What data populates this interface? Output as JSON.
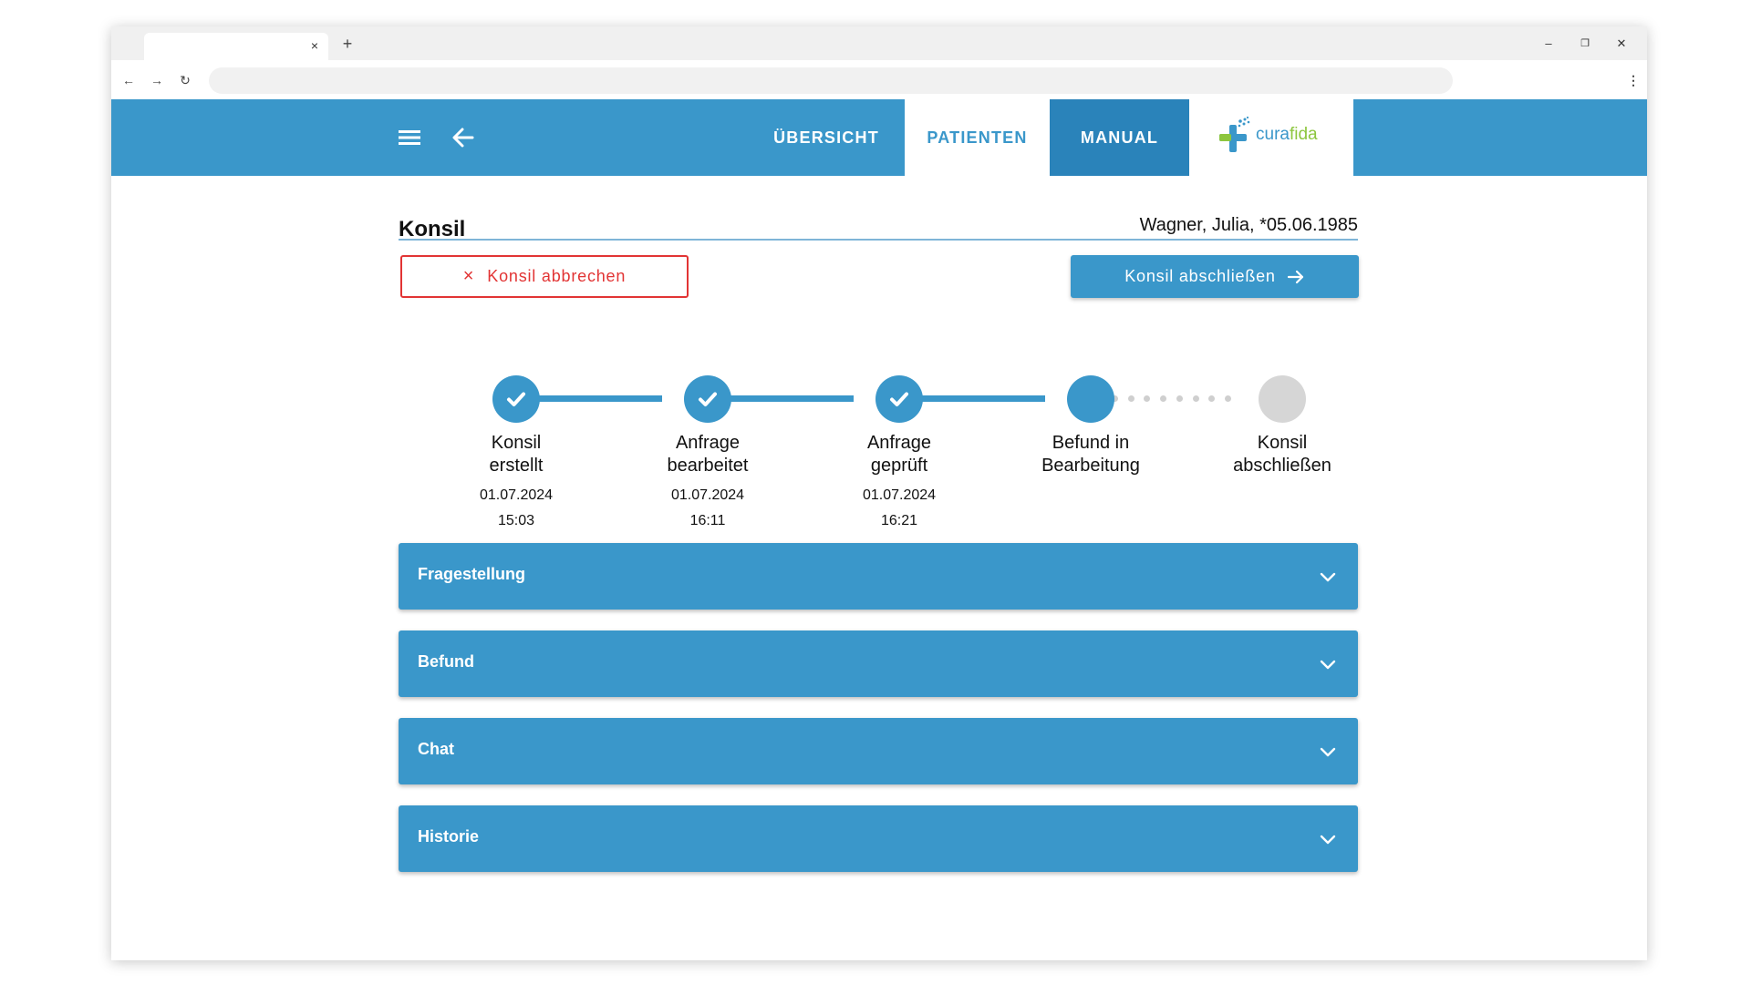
{
  "browser": {
    "tab_close": "×",
    "new_tab": "+",
    "back": "←",
    "forward": "→",
    "reload": "↻",
    "menu": "⋮",
    "minimize": "–",
    "restore": "❐",
    "close": "✕"
  },
  "nav": {
    "tabs": [
      {
        "label": "ÜBERSICHT"
      },
      {
        "label": "PATIENTEN"
      },
      {
        "label": "MANUAL"
      }
    ],
    "logo": {
      "part1": "cura",
      "part2": "fida"
    }
  },
  "header": {
    "title": "Konsil",
    "patient": "Wagner, Julia, *05.06.1985"
  },
  "actions": {
    "cancel_label": "Konsil abbrechen",
    "cancel_icon": "×",
    "finish_label": "Konsil abschließen"
  },
  "steps": [
    {
      "line1": "Konsil",
      "line2": "erstellt",
      "date": "01.07.2024",
      "time": "15:03",
      "status": "done"
    },
    {
      "line1": "Anfrage",
      "line2": "bearbeitet",
      "date": "01.07.2024",
      "time": "16:11",
      "status": "done"
    },
    {
      "line1": "Anfrage",
      "line2": "geprüft",
      "date": "01.07.2024",
      "time": "16:21",
      "status": "done"
    },
    {
      "line1": "Befund in",
      "line2": "Bearbeitung",
      "status": "current"
    },
    {
      "line1": "Konsil",
      "line2": "abschließen",
      "status": "pending"
    }
  ],
  "panels": [
    {
      "title": "Fragestellung"
    },
    {
      "title": "Befund"
    },
    {
      "title": "Chat"
    },
    {
      "title": "Historie"
    }
  ],
  "colors": {
    "primary": "#3a97ca",
    "danger": "#e23434",
    "pending": "#d6d6d6",
    "logo_green": "#8dc63f"
  }
}
